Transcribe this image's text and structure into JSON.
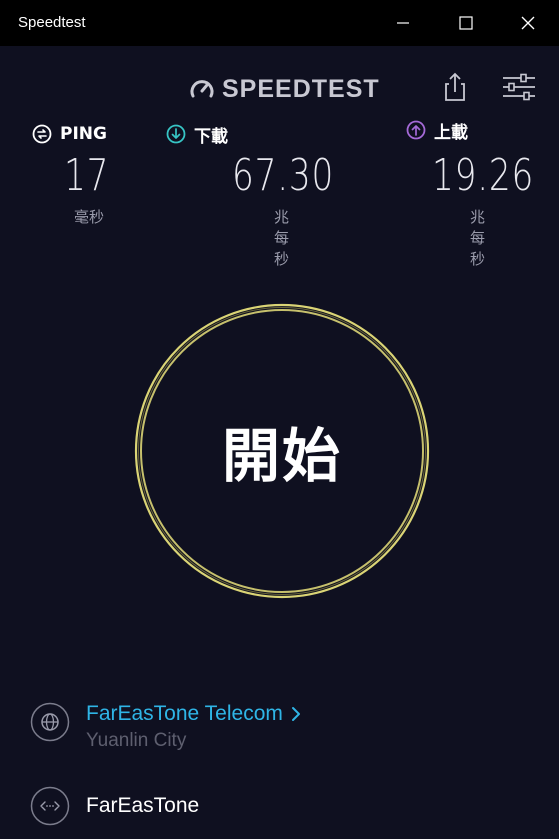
{
  "window": {
    "title": "Speedtest"
  },
  "header": {
    "logo_text": "SPEEDTEST"
  },
  "metrics": {
    "ping": {
      "label": "PING",
      "value": "17",
      "unit": "毫秒",
      "color": "#ffffff"
    },
    "download": {
      "label": "下載",
      "value": "67.30",
      "unit": "兆每秒",
      "color": "#37c5c5"
    },
    "upload": {
      "label": "上載",
      "value": "19.26",
      "unit": "兆每秒",
      "color": "#a56ad8"
    }
  },
  "start_button": {
    "label": "開始",
    "ring_color": "#e6df7a"
  },
  "server": {
    "provider": "FarEasTone Telecom",
    "city": "Yuanlin City",
    "isp": "FarEasTone"
  },
  "colors": {
    "background": "#0f1020",
    "titlebar": "#000000",
    "accent_link": "#2fb5e6"
  }
}
